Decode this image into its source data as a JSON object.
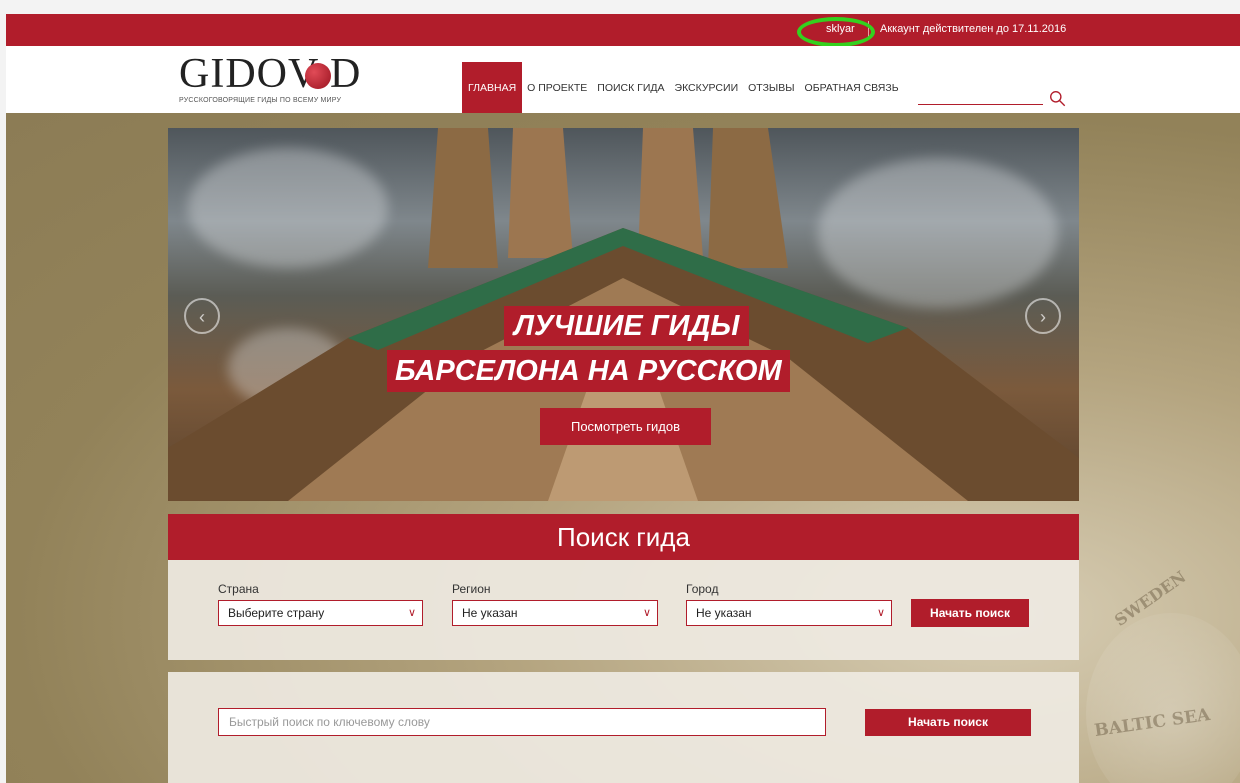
{
  "topbar": {
    "username": "sklyar",
    "account_status": "Аккаунт действителен до 17.11.2016"
  },
  "header": {
    "logo_text": "GIDOV D",
    "logo_tagline": "РУССКОГОВОРЯЩИЕ ГИДЫ ПО ВСЕМУ МИРУ",
    "nav": [
      {
        "label": "ГЛАВНАЯ",
        "active": true
      },
      {
        "label": "О ПРОЕКТЕ",
        "active": false
      },
      {
        "label": "ПОИСК ГИДА",
        "active": false
      },
      {
        "label": "ЭКСКУРСИИ",
        "active": false
      },
      {
        "label": "ОТЗЫВЫ",
        "active": false
      },
      {
        "label": "ОБРАТНАЯ СВЯЗЬ",
        "active": false
      }
    ],
    "search_icon": "search-icon"
  },
  "hero": {
    "line1": "ЛУЧШИЕ ГИДЫ",
    "line2": "БАРСЕЛОНА НА РУССКОМ",
    "cta": "Посмотреть гидов",
    "prev_icon": "arrow-left-icon",
    "next_icon": "arrow-right-icon"
  },
  "guide_search": {
    "title": "Поиск гида",
    "country": {
      "label": "Страна",
      "value": "Выберите страну"
    },
    "region": {
      "label": "Регион",
      "value": "Не указан"
    },
    "city": {
      "label": "Город",
      "value": "Не указан"
    },
    "submit": "Начать поиск"
  },
  "quick_search": {
    "placeholder": "Быстрый поиск по ключевому слову",
    "submit": "Начать поиск"
  },
  "background_map_labels": [
    "SWEDEN",
    "BALTIC SEA"
  ],
  "colors": {
    "brand_red": "#b11d2b",
    "highlight_green": "#34d11e",
    "background": "#9a8a62"
  }
}
